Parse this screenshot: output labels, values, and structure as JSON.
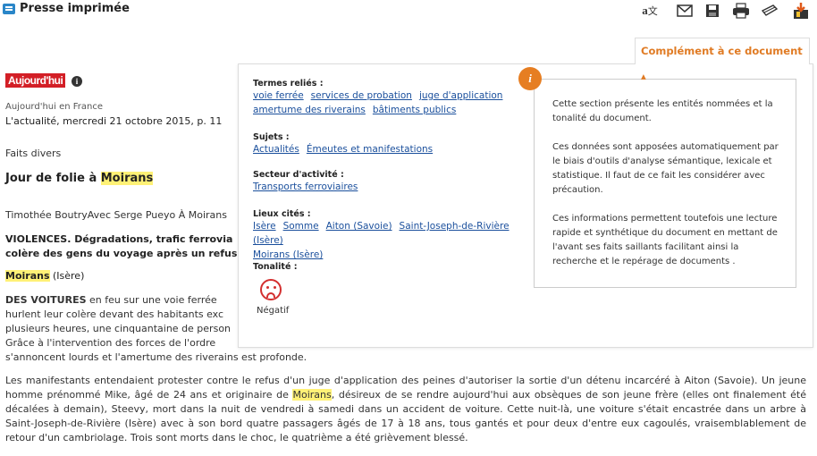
{
  "header": {
    "title": "Presse imprimée",
    "icons": [
      "translate-icon",
      "email-icon",
      "save-icon",
      "print-icon",
      "send-icon",
      "download-icon"
    ]
  },
  "article": {
    "logo": "Aujourd'hui",
    "source": "Aujourd'hui en France",
    "dateline": "L'actualité, mercredi 21 octobre 2015, p. 11",
    "rubric": "Faits divers",
    "headline_pre": "Jour de folie à ",
    "headline_hl": "Moirans",
    "author": "Timothée BoutryAvec Serge Pueyo À Moirans",
    "lead_line1": "VIOLENCES. Dégradations, trafic ferrovia",
    "lead_line2": "colère des gens du voyage après un refus",
    "place_hl": "Moirans",
    "place_rest": " (Isère)",
    "p1_strong": "DES VOITURES",
    "p1_line1": " en feu sur une voie ferrée",
    "p1_line2": "hurlent leur colère devant des habitants exc",
    "p1_line3": "plusieurs heures, une cinquantaine de person",
    "p1_line4": "Grâce à l'intervention des forces de l'ordre",
    "p1_line5": "s'annoncent lourds et l'amertume des riverains est profonde.",
    "p2_a": "Les manifestants entendaient protester contre le refus d'un juge d'application des peines d'autoriser la sortie d'un détenu incarcéré à Aiton (Savoie). Un jeune homme prénommé Mike, âgé de 24 ans et originaire de ",
    "p2_hl": "Moirans",
    "p2_b": ", désireux de se rendre aujourd'hui aux obsèques de son jeune frère (elles ont finalement été décalées à demain), Steevy, mort dans la nuit de vendredi à samedi dans un accident de voiture. Cette nuit-là, une voiture s'était encastrée dans un arbre à Saint-Joseph-de-Rivière (Isère) avec à son bord quatre passagers âgés de 17 à 18 ans, tous gantés et pour deux d'entre eux cagoulés, vraisemblablement de retour d'un cambriolage. Trois sont morts dans le choc, le quatrième a été grièvement blessé."
  },
  "complement": {
    "tab_label": "Complément à ce document ▴",
    "termes_heading": "Termes reliés :",
    "termes": [
      "voie ferrée",
      "services de probation",
      "juge d'application",
      "amertume des riverains",
      "bâtiments publics"
    ],
    "sujets_heading": "Sujets :",
    "sujets": [
      "Actualités",
      "Émeutes et manifestations"
    ],
    "secteur_heading": "Secteur d'activité :",
    "secteur": [
      "Transports ferroviaires"
    ],
    "lieux_heading": "Lieux cités :",
    "lieux": [
      "Isère",
      "Somme",
      "Aiton (Savoie)",
      "Saint-Joseph-de-Rivière (Isère)",
      "Moirans (Isère)"
    ],
    "tonalite_heading": "Tonalité :",
    "tonalite": "Négatif",
    "note_p1": "Cette section présente les entités nommées et la tonalité du document.",
    "note_p2": "Ces données sont apposées automatiquement par le biais d'outils d'analyse sémantique, lexicale et statistique. Il faut de ce fait les considérer avec précaution.",
    "note_p3": "Ces informations permettent toutefois une lecture rapide et synthétique du document en mettant de l'avant ses faits saillants facilitant ainsi la recherche et le repérage de documents .",
    "note_icon": "i"
  }
}
